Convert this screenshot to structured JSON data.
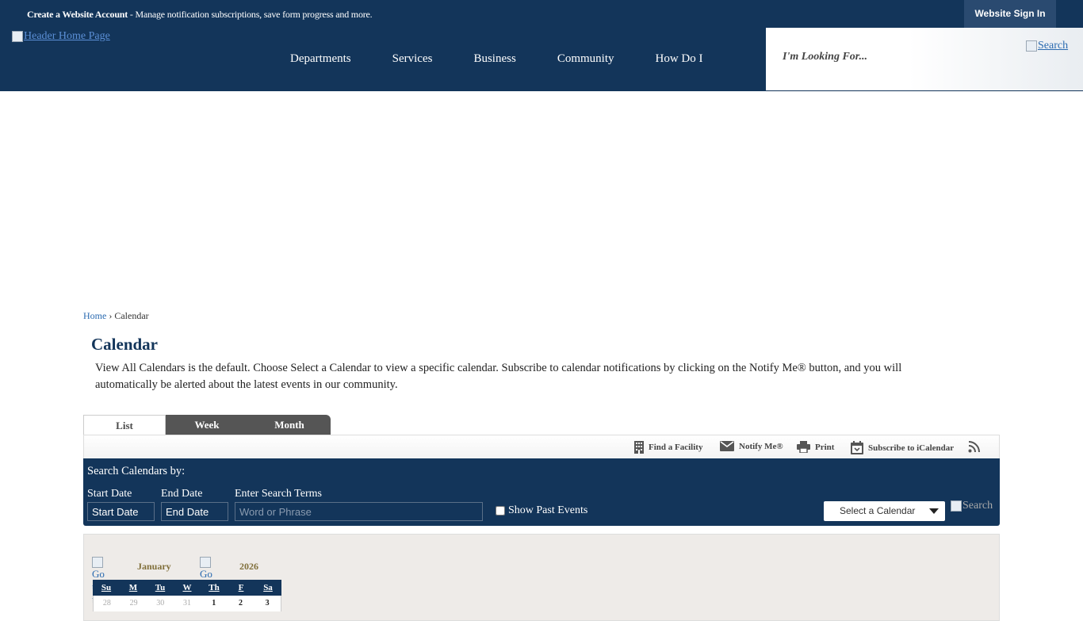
{
  "topbar": {
    "create_account": "Create a Website Account",
    "message": " - Manage notification subscriptions, save form progress and more.",
    "sign_in": "Website Sign In"
  },
  "header": {
    "logo_alt": "Header Home Page",
    "nav": [
      "Departments",
      "Services",
      "Business",
      "Community",
      "How Do I"
    ],
    "search_placeholder": "I'm Looking For...",
    "search_alt": "Search"
  },
  "breadcrumb": {
    "home": "Home",
    "separator": "›",
    "current": "Calendar"
  },
  "page": {
    "title": "Calendar",
    "intro": "View All Calendars is the default. Choose Select a Calendar to view a specific calendar. Subscribe to calendar notifications by clicking on the Notify Me® button, and you will automatically be alerted about the latest events in our community."
  },
  "tabs": [
    "List",
    "Week",
    "Month"
  ],
  "toolbar": {
    "find_facility": "Find a Facility",
    "notify": "Notify Me®",
    "print": "Print",
    "subscribe": "Subscribe to iCalendar"
  },
  "search_panel": {
    "title": "Search Calendars by:",
    "start_label": "Start Date",
    "end_label": "End Date",
    "terms_label": "Enter Search Terms",
    "start_placeholder": "Start Date",
    "end_placeholder": "End Date",
    "terms_placeholder": "Word or Phrase",
    "past_events": "Show Past Events",
    "select_calendar": "Select a Calendar",
    "search_alt": "Search"
  },
  "mini_calendar": {
    "prev_alt": "Go to previous month",
    "next_alt": "Go to next month",
    "month": "January",
    "year": "2026",
    "weekdays": [
      "Su",
      "M",
      "Tu",
      "W",
      "Th",
      "F",
      "Sa"
    ],
    "first_row": [
      "28",
      "29",
      "30",
      "31",
      "1",
      "2",
      "3"
    ]
  },
  "colors": {
    "navy": "#13355a",
    "accent_link": "#2a6ab0",
    "tab_inactive": "#555555",
    "calendar_bg": "#eeebe8"
  }
}
